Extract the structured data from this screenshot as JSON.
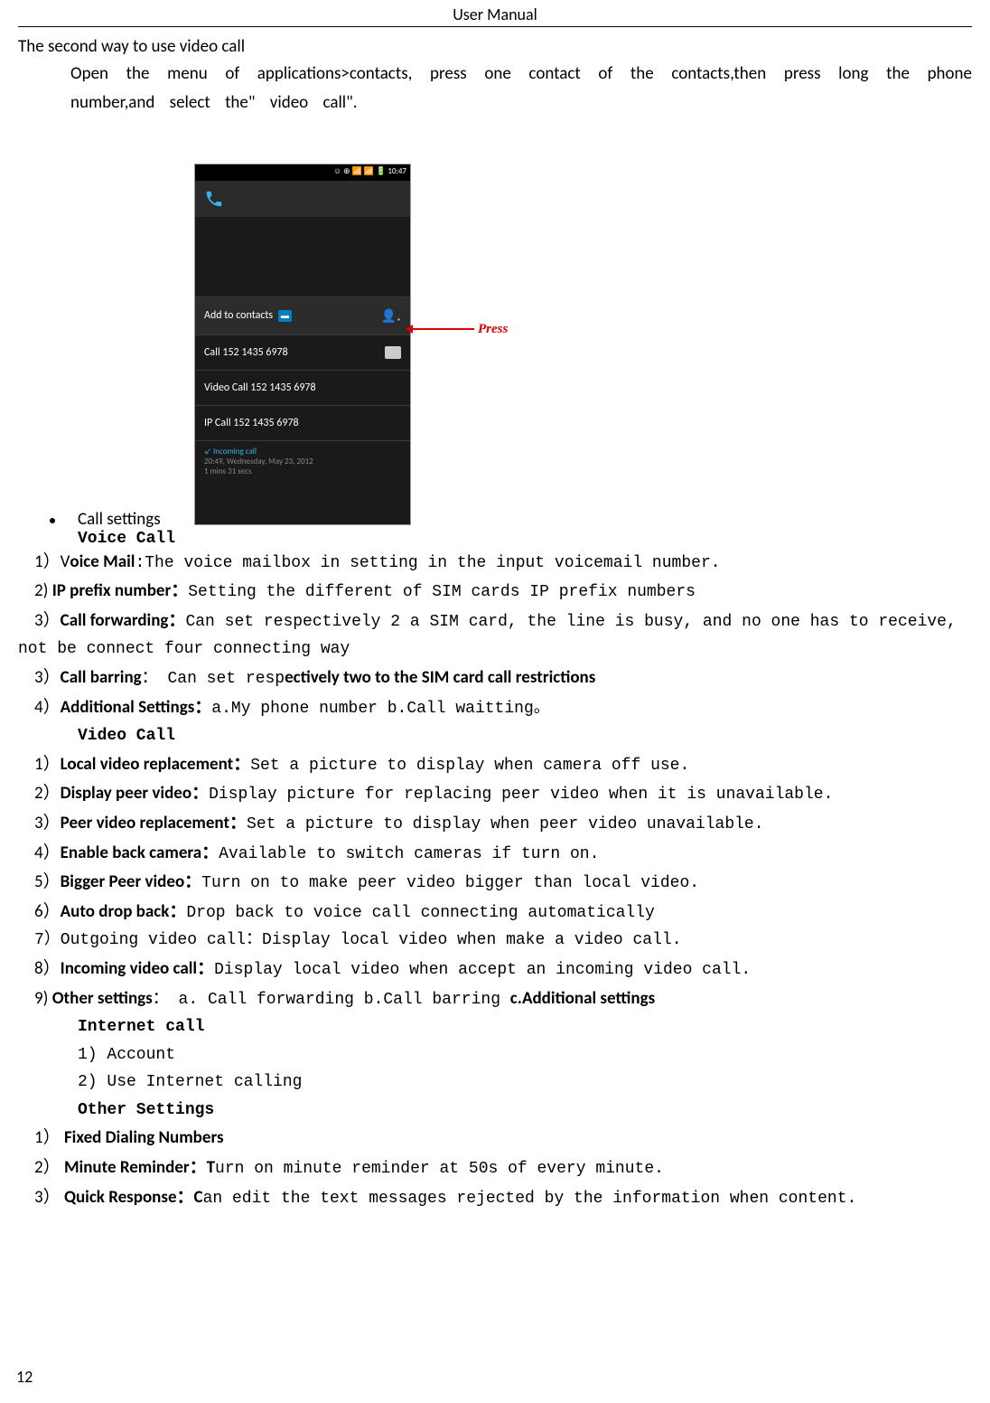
{
  "header": "User    Manual",
  "section_title": "The second way to use video call",
  "instruction": "Open  the  menu  of  applications>contacts,  press    one  contact  of  the  contacts,then  press  long  the  phone number,and select the\" video call\".",
  "phone": {
    "status_time": "10:47",
    "menu": {
      "add_contacts": "Add to contacts",
      "call": "Call 152 1435 6978",
      "video_call": "Video Call 152 1435 6978",
      "ip_call": "IP Call 152 1435 6978"
    },
    "incoming": {
      "label": "Incoming call",
      "datetime": "20:49, Wednesday, May 23, 2012",
      "duration": "1 mins 31 secs"
    }
  },
  "annotation": {
    "press": "Press"
  },
  "bullet": {
    "label": "Call settings",
    "voice_call_heading": "Voice Call"
  },
  "voice_call": {
    "i1_num": "1）V",
    "i1_bold": "oice Mail",
    "i1_rest": ":The voice mailbox in setting in the input voicemail number.",
    "i2_num": "2) ",
    "i2_bold": "IP prefix number：",
    "i2_rest": "Setting the different of SIM cards IP prefix numbers",
    "i3_num": "3）",
    "i3_bold": "Call forwarding：",
    "i3_rest": "Can set respectively 2 a SIM card, the line is busy, and no one has to receive,",
    "i3_cont": "not be connect four connecting way",
    "i4_num": "3）",
    "i4_bold": "Call barring",
    "i4_mid": "： Can set resp",
    "i4_rest_bold": "ectively two to the SIM card call restrictions",
    "i5_num": "4）",
    "i5_bold": "Additional Settings：",
    "i5_rest": "a.My phone number b.Call waitting。"
  },
  "video_call_heading": "Video Call",
  "video_call": {
    "i1_num": "1）",
    "i1_bold": "Local video replacement：",
    "i1_rest": "Set a picture to display when camera off use.",
    "i2_num": "2）",
    "i2_bold": "Display peer video：",
    "i2_rest": "Display picture for replacing peer video when it is unavailable.",
    "i3_num": "3）",
    "i3_bold": "Peer video replacement：",
    "i3_rest": "Set a picture to display when peer video unavailable.",
    "i4_num": "4）",
    "i4_bold": "Enable back camera：",
    "i4_rest": "Available to switch cameras if turn on.",
    "i5_num": "5）",
    "i5_bold": "Bigger Peer video：",
    "i5_rest": "Turn on to make peer video bigger than local video.",
    "i6_num": "6）",
    "i6_bold": "Auto drop back：",
    "i6_rest": "Drop back to voice call connecting automatically",
    "i7": "7）Outgoing video call：Display local video when make a video call.",
    "i8_num": "8）",
    "i8_bold": "Incoming video call：",
    "i8_rest": "Display local video when accept an incoming video call.",
    "i9_num": "9) ",
    "i9_bold": "Other settings",
    "i9_mid": "：  a. Call forwarding  b.Call barring  ",
    "i9_end_bold": "c.Additional settings"
  },
  "internet_heading": "Internet call",
  "internet": {
    "i1": "1)  Account",
    "i2": "2)  Use Internet calling"
  },
  "other_heading": "Other Settings",
  "other": {
    "i1_num": "1） ",
    "i1_bold": "Fixed Dialing Numbers",
    "i2_num": "2） ",
    "i2_bold": "Minute Reminder：T",
    "i2_rest": "urn on minute reminder at 50s of every minute.",
    "i3_num": "3） ",
    "i3_bold": "Quick Response：C",
    "i3_rest": "an edit the text messages rejected by the information when content."
  },
  "page_number": "12"
}
